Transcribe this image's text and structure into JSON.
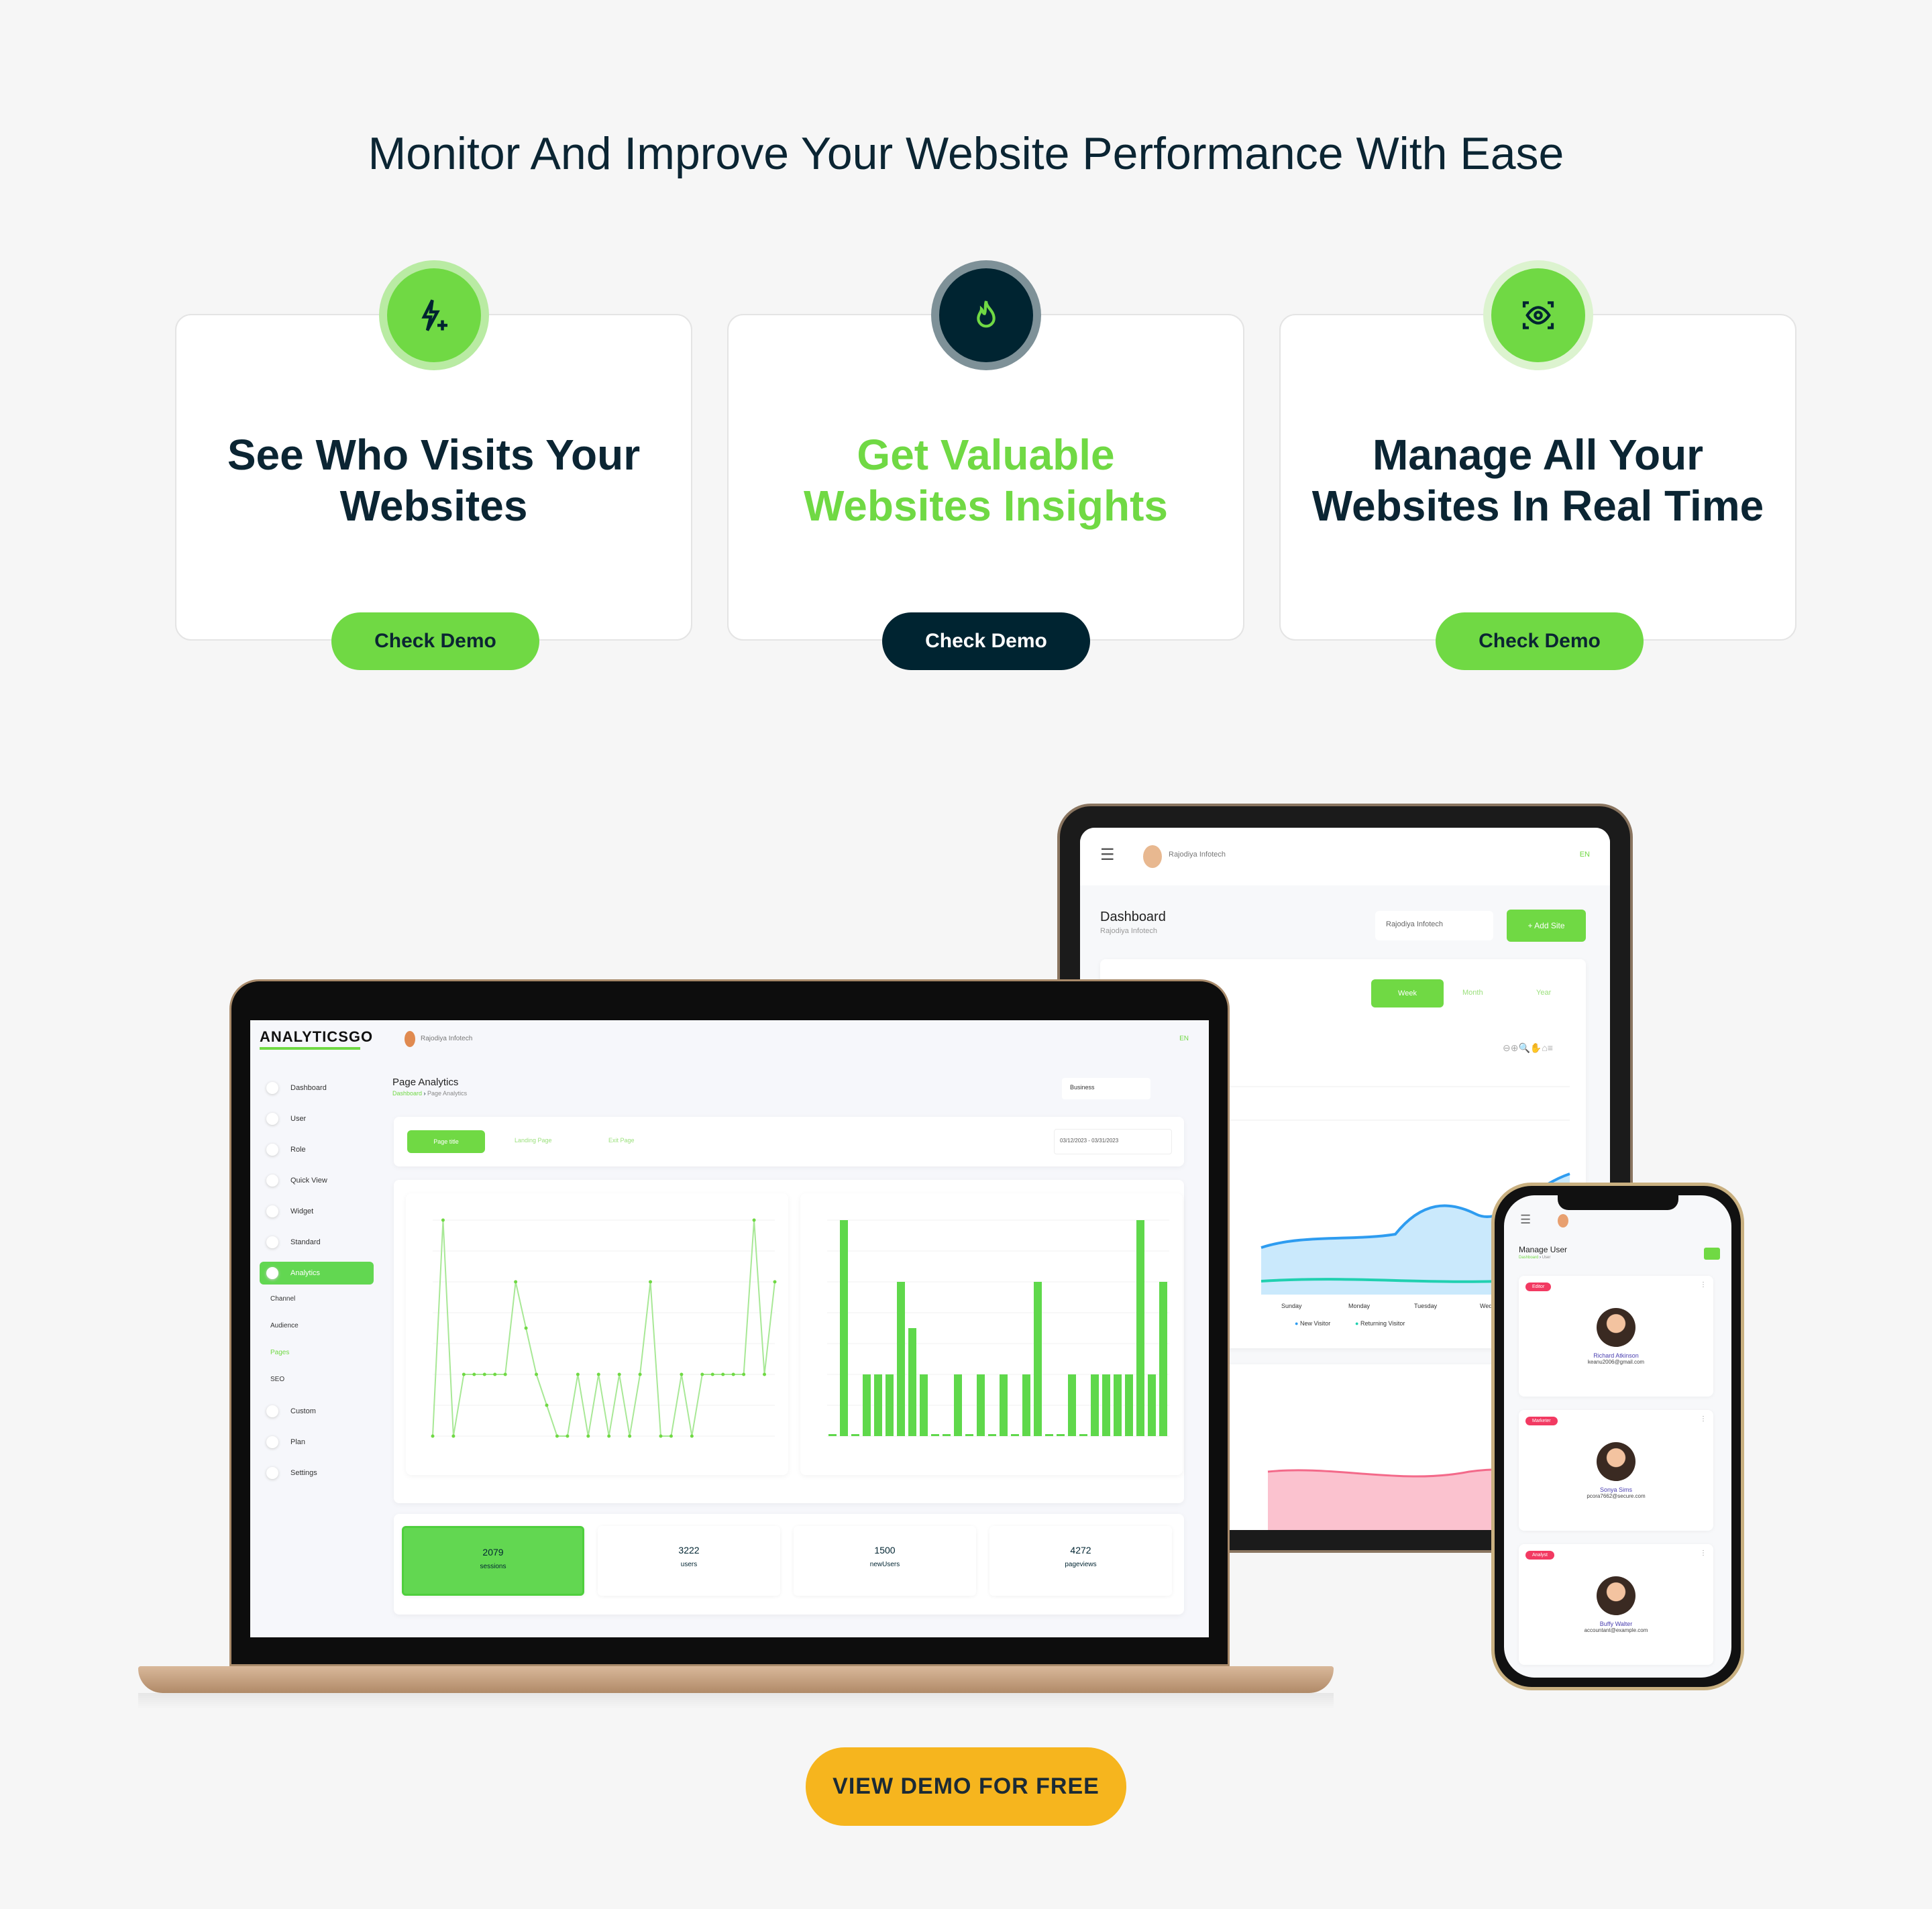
{
  "headline": "Monitor And Improve Your Website Performance With Ease",
  "colors": {
    "green": "#70D944",
    "navy": "#002431",
    "cta": "#F6B51E",
    "background": "#F6F6F6"
  },
  "cards": [
    {
      "icon": "bolt-plus-icon",
      "title_line1": "See Who Visits Your",
      "title_line2": "Websites",
      "button": "Check Demo",
      "variant": "green"
    },
    {
      "icon": "flame-icon",
      "title_line1": "Get Valuable",
      "title_line2": "Websites Insights",
      "button": "Check Demo",
      "variant": "navy"
    },
    {
      "icon": "eye-scan-icon",
      "title_line1": "Manage All Your",
      "title_line2": "Websites In Real Time",
      "button": "Check Demo",
      "variant": "green"
    }
  ],
  "laptop": {
    "logo": "ANALYTICSGO",
    "user": "Rajodiya Infotech",
    "lang": "EN",
    "page_title": "Page Analytics",
    "breadcrumb": [
      "Dashboard",
      "Page Analytics"
    ],
    "select": "Business",
    "tabs": [
      "Page title",
      "Landing Page",
      "Exit Page"
    ],
    "date_range": "03/12/2023 - 03/31/2023",
    "sidebar": [
      "Dashboard",
      "User",
      "Role",
      "Quick View",
      "Widget",
      "Standard",
      "Analytics",
      "Custom",
      "Plan",
      "Settings"
    ],
    "analytics_sub": [
      "Channel",
      "Audience",
      "Pages",
      "SEO"
    ],
    "line_values": [
      0,
      7,
      0,
      2,
      2,
      2,
      2,
      2,
      5,
      3.5,
      2,
      1,
      0,
      0,
      2,
      0,
      2,
      0,
      2,
      0,
      2,
      5,
      0,
      0,
      2,
      0,
      2,
      2,
      2,
      2,
      2,
      7,
      2,
      5
    ],
    "bar_values": [
      0,
      7,
      0,
      2,
      2,
      2,
      5,
      3.5,
      2,
      0,
      0,
      2,
      0,
      2,
      0,
      2,
      0,
      2,
      5,
      0,
      0,
      2,
      0,
      2,
      2,
      2,
      2,
      7,
      2,
      5
    ],
    "stats": [
      {
        "value": "2079",
        "label": "sessions"
      },
      {
        "value": "3222",
        "label": "users"
      },
      {
        "value": "1500",
        "label": "newUsers"
      },
      {
        "value": "4272",
        "label": "pageviews"
      }
    ]
  },
  "tablet": {
    "user": "Rajodiya Infotech",
    "lang": "EN",
    "title": "Dashboard",
    "subtitle": "Rajodiya Infotech",
    "select": "Rajodiya Infotech",
    "add_button": "+ Add Site",
    "periods": [
      "Week",
      "Month",
      "Year"
    ],
    "days": [
      "Sunday",
      "Monday",
      "Tuesday",
      "Wednesday"
    ],
    "legend": [
      "New Visitor",
      "Returning Visitor"
    ]
  },
  "phone": {
    "title": "Manage User",
    "breadcrumb": [
      "Dashboard",
      "User"
    ],
    "users": [
      {
        "role": "Editor",
        "name": "Richard Atkinson",
        "email": "keanu2006@gmail.com"
      },
      {
        "role": "Marketer",
        "name": "Sonya Sims",
        "email": "pcora7662@secure.com"
      },
      {
        "role": "Analyst",
        "name": "Buffy Walter",
        "email": "accountant@example.com"
      }
    ]
  },
  "cta": "VIEW DEMO FOR FREE"
}
